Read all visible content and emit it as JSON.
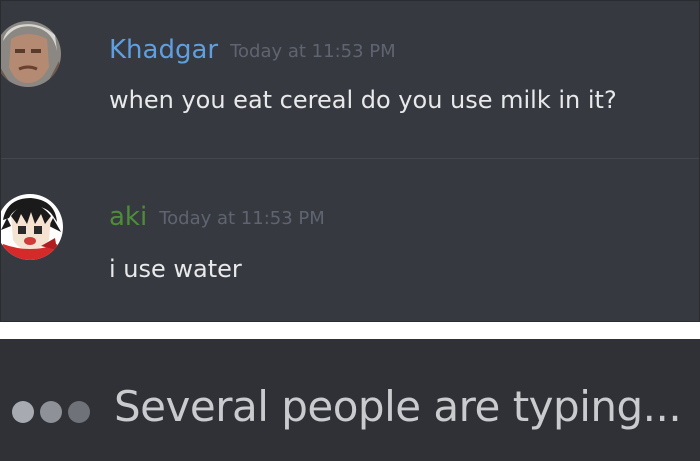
{
  "messages": [
    {
      "author": "Khadgar",
      "timestamp": "Today at 11:53 PM",
      "text": "when you eat cereal do you use milk in it?",
      "author_color": "#5f9fe0"
    },
    {
      "author": "aki",
      "timestamp": "Today at 11:53 PM",
      "text": "i use water",
      "author_color": "#4f8c3a"
    }
  ],
  "typing_indicator": {
    "text": "Several people are typing..."
  },
  "colors": {
    "chat_background": "#36393f",
    "typing_background": "#2f3136",
    "message_text": "#e8e9ea",
    "timestamp": "#5f6470"
  }
}
